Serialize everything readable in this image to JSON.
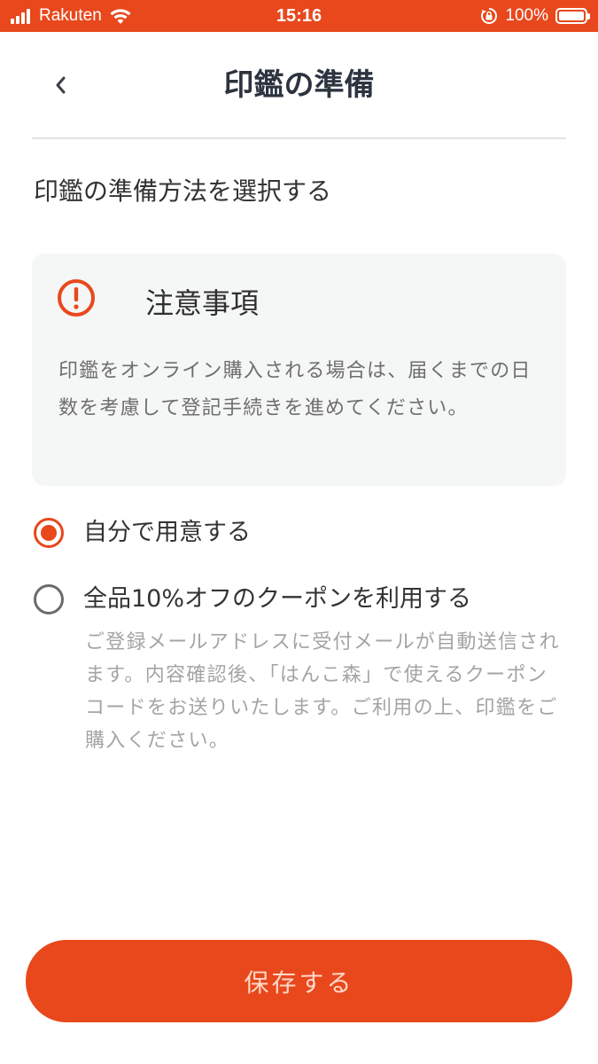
{
  "status_bar": {
    "carrier": "Rakuten",
    "time": "15:16",
    "battery_percent": "100%",
    "battery_level": 1.0,
    "background_color": "#e8481c"
  },
  "header": {
    "title": "印鑑の準備",
    "back_icon": "chevron-left-icon"
  },
  "section_title": "印鑑の準備方法を選択する",
  "notice": {
    "icon": "exclamation-circle-icon",
    "title": "注意事項",
    "body": "印鑑をオンライン購入される場合は、届くまでの日数を考慮して登記手続きを進めてください。"
  },
  "options": [
    {
      "label": "自分で用意する",
      "selected": true
    },
    {
      "label": "全品10%オフのクーポンを利用する",
      "selected": false,
      "description": "ご登録メールアドレスに受付メールが自動送信されます。内容確認後、「はんこ森」で使えるクーポンコードをお送りいたします。ご利用の上、印鑑をご購入ください。"
    }
  ],
  "save_button": {
    "label": "保存する"
  },
  "colors": {
    "accent": "#e8481c",
    "card_background": "#f5f6f6",
    "muted_text": "#a4a4a4"
  }
}
